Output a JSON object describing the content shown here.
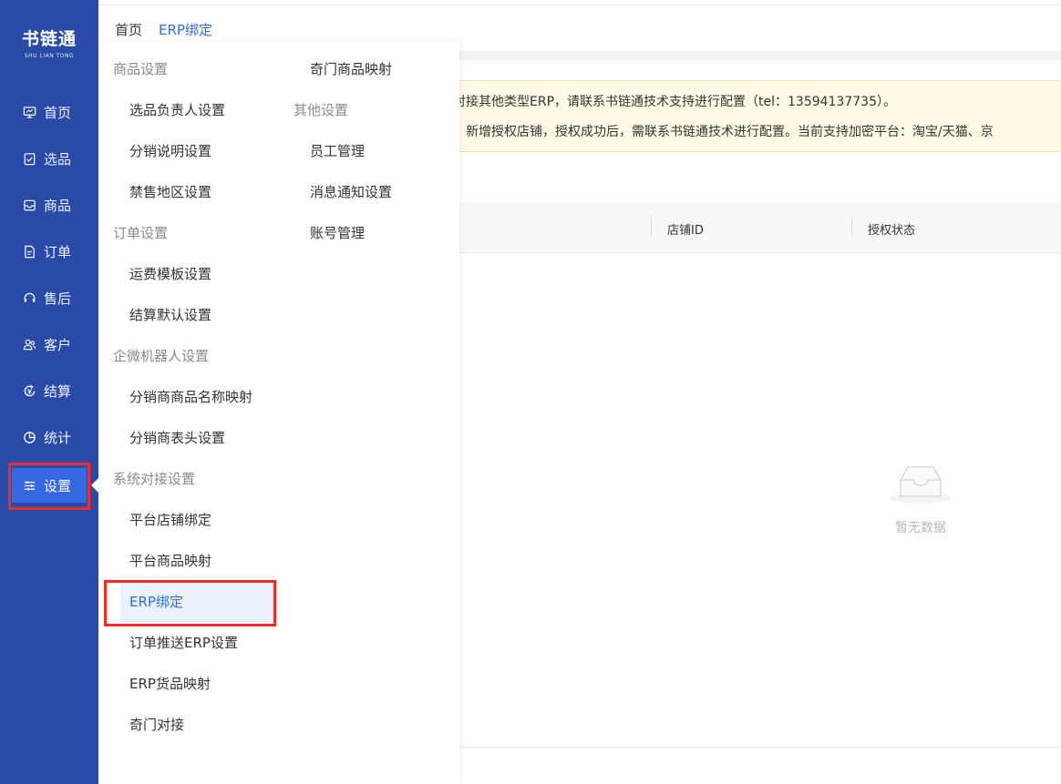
{
  "logo": {
    "main": "书链通",
    "sub": "SHU LIAN TONG"
  },
  "sidebar": {
    "items": [
      {
        "label": "首页",
        "icon": "monitor-icon"
      },
      {
        "label": "选品",
        "icon": "clipboard-check-icon"
      },
      {
        "label": "商品",
        "icon": "inbox-icon"
      },
      {
        "label": "订单",
        "icon": "document-icon"
      },
      {
        "label": "售后",
        "icon": "headset-icon"
      },
      {
        "label": "客户",
        "icon": "users-icon"
      },
      {
        "label": "结算",
        "icon": "settlement-icon"
      },
      {
        "label": "统计",
        "icon": "pie-chart-icon"
      },
      {
        "label": "设置",
        "icon": "sliders-icon",
        "active": true
      }
    ]
  },
  "breadcrumb": {
    "home": "首页",
    "current": "ERP绑定"
  },
  "menu": {
    "left": [
      {
        "type": "group",
        "label": "商品设置"
      },
      {
        "type": "item",
        "label": "选品负责人设置"
      },
      {
        "type": "item",
        "label": "分销说明设置"
      },
      {
        "type": "item",
        "label": "禁售地区设置"
      },
      {
        "type": "group",
        "label": "订单设置"
      },
      {
        "type": "item",
        "label": "运费模板设置"
      },
      {
        "type": "item",
        "label": "结算默认设置"
      },
      {
        "type": "group",
        "label": "企微机器人设置"
      },
      {
        "type": "item",
        "label": "分销商商品名称映射"
      },
      {
        "type": "item",
        "label": "分销商表头设置"
      },
      {
        "type": "group",
        "label": "系统对接设置"
      },
      {
        "type": "item",
        "label": "平台店铺绑定"
      },
      {
        "type": "item",
        "label": "平台商品映射"
      },
      {
        "type": "item",
        "label": "ERP绑定",
        "active": true
      },
      {
        "type": "item",
        "label": "订单推送ERP设置"
      },
      {
        "type": "item",
        "label": "ERP货品映射"
      },
      {
        "type": "item",
        "label": "奇门对接"
      }
    ],
    "right": [
      {
        "type": "item",
        "label": "奇门商品映射"
      },
      {
        "type": "group",
        "label": "其他设置"
      },
      {
        "type": "item",
        "label": "员工管理"
      },
      {
        "type": "item",
        "label": "消息通知设置"
      },
      {
        "type": "item",
        "label": "账号管理"
      }
    ]
  },
  "notice": {
    "line1": "对接其他类型ERP，请联系书链通技术支持进行配置（tel：13594137735）。",
    "line2": "，新增授权店铺，授权成功后，需联系书链通技术进行配置。当前支持加密平台：淘宝/天猫、京"
  },
  "table": {
    "columns": [
      "店铺ID",
      "授权状态"
    ],
    "empty_text": "暂无数据"
  },
  "colors": {
    "sidebar": "#2a4aa8",
    "accent": "#2f6fe0",
    "highlight": "#ef2b2b"
  }
}
